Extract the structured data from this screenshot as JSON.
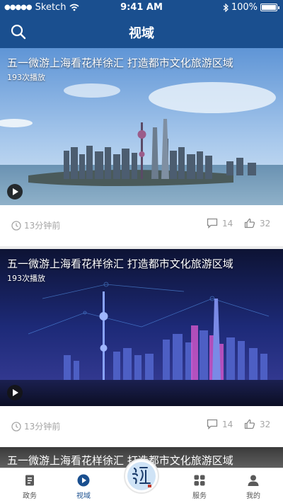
{
  "status_bar": {
    "carrier": "Sketch",
    "time": "9:41 AM",
    "battery": "100%"
  },
  "nav": {
    "title": "视域"
  },
  "videos": [
    {
      "title": "五一微游上海看花样徐汇 打造都市文化旅游区域",
      "plays": "193次播放",
      "time": "13分钟前",
      "comments": "14",
      "likes": "32"
    },
    {
      "title": "五一微游上海看花样徐汇 打造都市文化旅游区域",
      "plays": "193次播放",
      "time": "13分钟前",
      "comments": "14",
      "likes": "32"
    }
  ],
  "partial_video": {
    "title": "五一微游上海看花样徐汇 打造都市文化旅游区域"
  },
  "tabs": [
    {
      "label": "政务",
      "icon": "document-icon"
    },
    {
      "label": "视域",
      "icon": "play-circle-icon"
    },
    {
      "label": "",
      "icon": "calligraphy-logo"
    },
    {
      "label": "服务",
      "icon": "grid-icon"
    },
    {
      "label": "我的",
      "icon": "user-icon"
    }
  ],
  "colors": {
    "brand": "#1a4f8f",
    "meta_text": "#a6a6a6"
  }
}
